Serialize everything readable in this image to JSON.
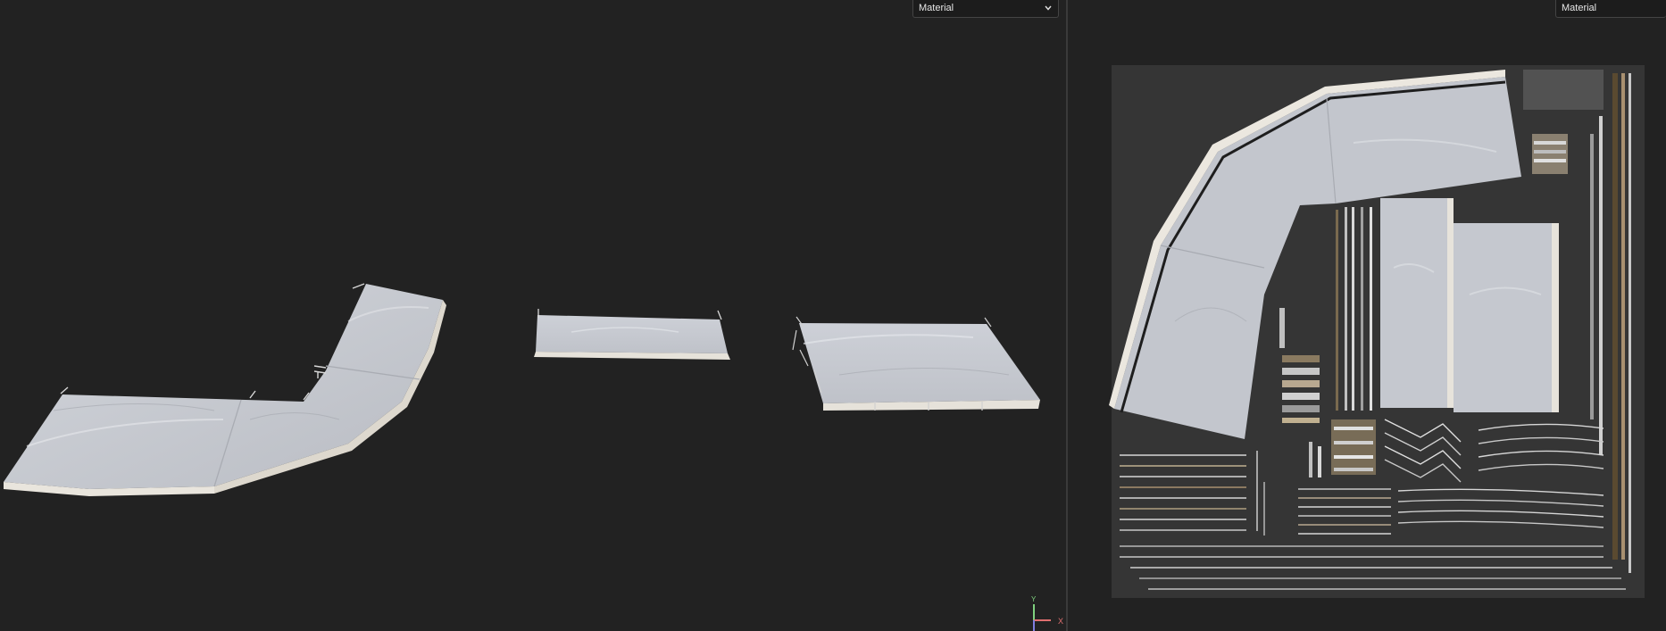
{
  "viewports": {
    "left": {
      "mode_select": {
        "value": "Material"
      },
      "gizmo": {
        "y_label": "Y",
        "x_label": "X"
      }
    },
    "right": {
      "mode_select": {
        "value": "Material"
      }
    }
  },
  "colors": {
    "background": "#222222",
    "cloth": "#c9ccd2",
    "trim": "#e8e4dc",
    "uv_canvas": "#353535",
    "gizmo_y": "#7fd17f",
    "gizmo_x": "#e07070",
    "gizmo_z": "#7f7fe0"
  },
  "icons": {
    "dropdown": "chevron-down-icon",
    "axis_gizmo": "axis-gizmo-icon"
  }
}
